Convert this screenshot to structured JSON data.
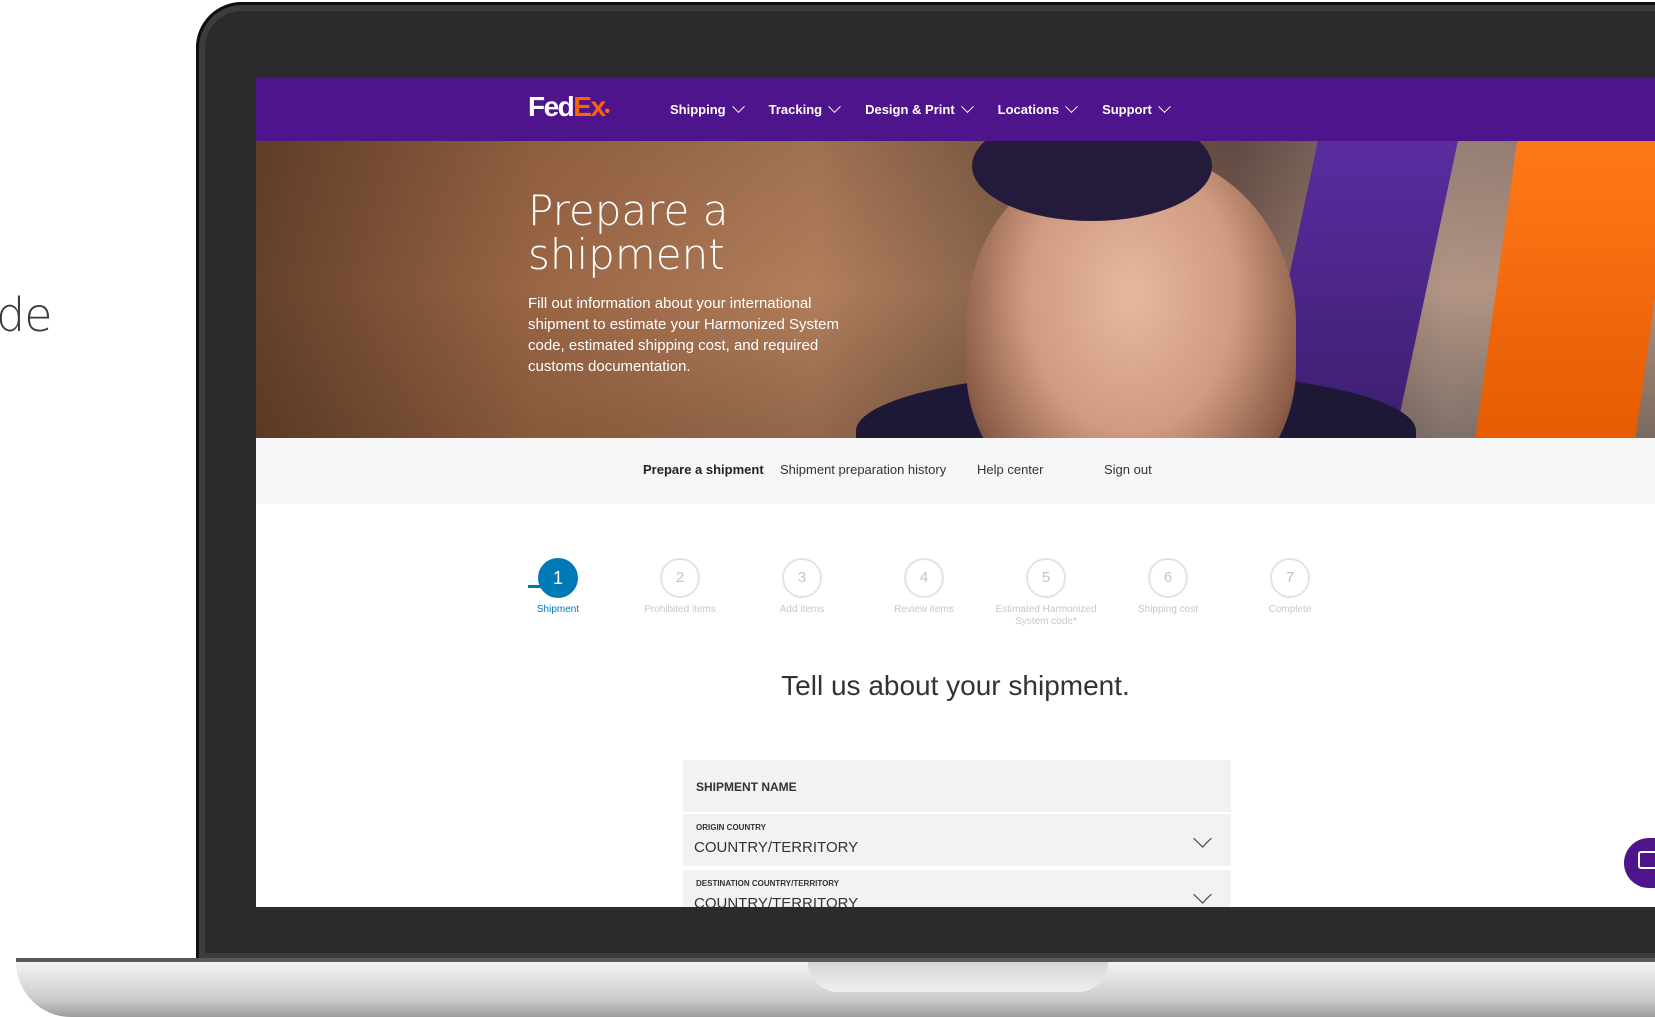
{
  "side_text": "de",
  "nav": {
    "logo_fed": "Fed",
    "logo_ex": "Ex",
    "items": [
      {
        "label": "Shipping"
      },
      {
        "label": "Tracking"
      },
      {
        "label": "Design & Print"
      },
      {
        "label": "Locations"
      },
      {
        "label": "Support"
      }
    ]
  },
  "hero": {
    "title": "Prepare a shipment",
    "description": "Fill out information about your international shipment to estimate your Harmonized System code, estimated shipping cost, and required customs documentation."
  },
  "subnav": {
    "items": [
      {
        "label": "Prepare a shipment",
        "active": true
      },
      {
        "label": "Shipment preparation history"
      },
      {
        "label": "Help center"
      },
      {
        "label": "Sign out"
      }
    ]
  },
  "steps": [
    {
      "number": "1",
      "label": "Shipment",
      "active": true
    },
    {
      "number": "2",
      "label": "Prohibited items"
    },
    {
      "number": "3",
      "label": "Add items"
    },
    {
      "number": "4",
      "label": "Review items"
    },
    {
      "number": "5",
      "label": "Estimated Harmonized System code*"
    },
    {
      "number": "6",
      "label": "Shipping cost"
    },
    {
      "number": "7",
      "label": "Complete"
    }
  ],
  "form": {
    "title": "Tell us about your shipment.",
    "shipment_name_label": "SHIPMENT NAME",
    "origin": {
      "label": "ORIGIN COUNTRY",
      "value": "COUNTRY/TERRITORY"
    },
    "destination": {
      "label": "DESTINATION COUNTRY/TERRITORY",
      "value": "COUNTRY/TERRITORY"
    }
  },
  "colors": {
    "brand_purple": "#4d148c",
    "brand_orange": "#ff6200",
    "step_active": "#007ab7"
  }
}
